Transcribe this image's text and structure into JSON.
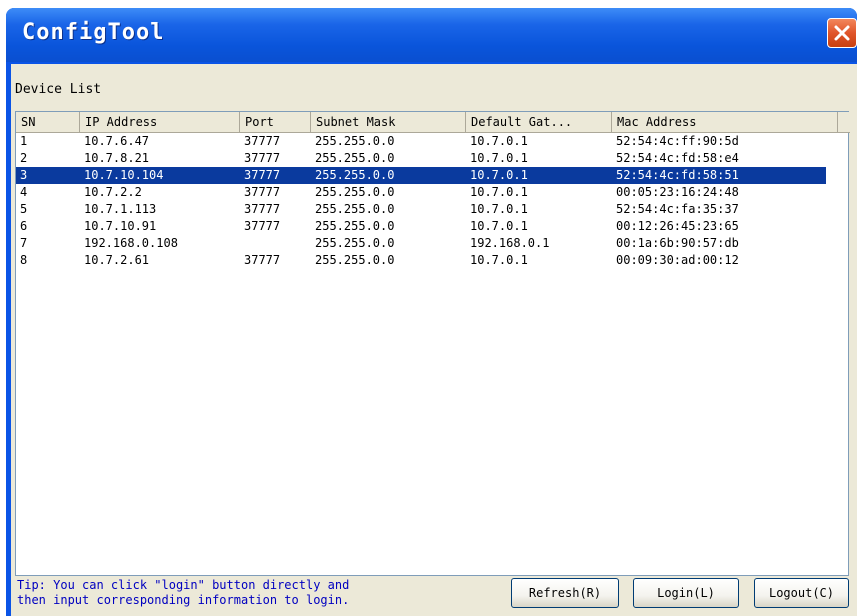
{
  "window": {
    "title": "ConfigTool"
  },
  "icons": {
    "close": "close-x-icon"
  },
  "colors": {
    "titlebar": "#0a55db",
    "selection": "#0a3a9e",
    "tip_text": "#0000c0",
    "close_button": "#e0552a"
  },
  "device_list": {
    "label": "Device List",
    "columns": [
      "SN",
      "IP Address",
      "Port",
      "Subnet Mask",
      "Default Gat...",
      "Mac Address"
    ],
    "selected_index": 2,
    "rows": [
      [
        "1",
        "10.7.6.47",
        "37777",
        "255.255.0.0",
        "10.7.0.1",
        "52:54:4c:ff:90:5d"
      ],
      [
        "2",
        "10.7.8.21",
        "37777",
        "255.255.0.0",
        "10.7.0.1",
        "52:54:4c:fd:58:e4"
      ],
      [
        "3",
        "10.7.10.104",
        "37777",
        "255.255.0.0",
        "10.7.0.1",
        "52:54:4c:fd:58:51"
      ],
      [
        "4",
        "10.7.2.2",
        "37777",
        "255.255.0.0",
        "10.7.0.1",
        "00:05:23:16:24:48"
      ],
      [
        "5",
        "10.7.1.113",
        "37777",
        "255.255.0.0",
        "10.7.0.1",
        "52:54:4c:fa:35:37"
      ],
      [
        "6",
        "10.7.10.91",
        "37777",
        "255.255.0.0",
        "10.7.0.1",
        "00:12:26:45:23:65"
      ],
      [
        "7",
        "192.168.0.108",
        "",
        "255.255.0.0",
        "192.168.0.1",
        "00:1a:6b:90:57:db"
      ],
      [
        "8",
        "10.7.2.61",
        "37777",
        "255.255.0.0",
        "10.7.0.1",
        "00:09:30:ad:00:12"
      ]
    ]
  },
  "tip": {
    "line1": "Tip: You can click \"login\" button directly and",
    "line2": "then input corresponding information to login."
  },
  "buttons": {
    "refresh": "Refresh(R)",
    "login": "Login(L)",
    "logout": "Logout(C)"
  }
}
